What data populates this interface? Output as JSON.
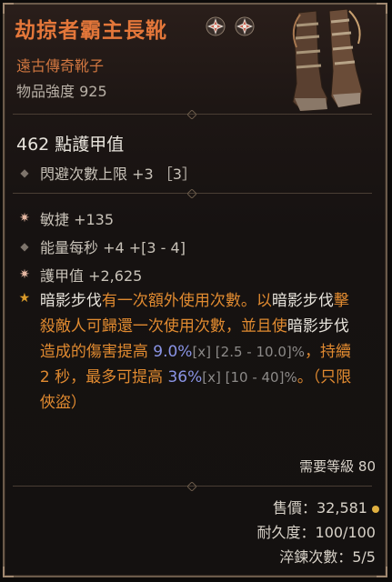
{
  "item": {
    "name": "劫掠者霸主長靴",
    "type": "遠古傳奇靴子",
    "item_power": "物品強度 925",
    "armor": "462 點護甲值",
    "implicit": "閃避次數上限 +3 ［3］",
    "affixes": [
      {
        "text": "敏捷 +135",
        "bullet": "star"
      },
      {
        "text": "能量每秒 +4 +[3 - 4]",
        "bullet": "diamond"
      },
      {
        "text": "護甲值 +2,625",
        "bullet": "star"
      }
    ],
    "aspect": [
      {
        "t": "暗影步伐",
        "c": "w"
      },
      {
        "t": "有一次額外使用次數。以",
        "c": "o"
      },
      {
        "t": "暗影步伐",
        "c": "w"
      },
      {
        "t": "擊殺敵人可歸還一次使用次數，並且使",
        "c": "o"
      },
      {
        "t": "暗影步伐",
        "c": "w"
      },
      {
        "t": "造成的傷害提高 ",
        "c": "o"
      },
      {
        "t": "9.0%",
        "c": "b"
      },
      {
        "t": "[x] [2.5 - 10.0]%",
        "c": "g"
      },
      {
        "t": "，持續 2 秒，最多可提高 ",
        "c": "o"
      },
      {
        "t": "36%",
        "c": "b"
      },
      {
        "t": "[x] [10 - 40]%",
        "c": "g"
      },
      {
        "t": "。（只限俠盜）",
        "c": "o"
      }
    ],
    "required_level": "需要等級 80",
    "sell_value": "售價：32,581",
    "durability": "耐久度：100/100",
    "temper": "淬鍊次數：5/5"
  },
  "colors": {
    "title": "#e4773a",
    "legendary_text": "#e08a30",
    "value_blue": "#8a94e6",
    "border": "#6b5a4a"
  },
  "icons": [
    "socket-gem-icon",
    "socket-gem-icon",
    "boots-icon",
    "diamond-bullet-icon",
    "star-bullet-icon",
    "gold-star-bullet-icon",
    "gold-coin-icon"
  ]
}
